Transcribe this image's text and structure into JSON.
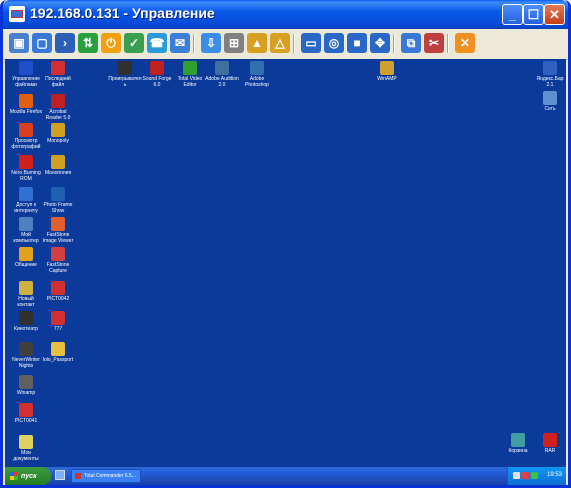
{
  "window": {
    "title": "192.168.0.131 - Управление"
  },
  "window_buttons": [
    {
      "name": "minimize-button",
      "glyph": "_"
    },
    {
      "name": "maximize-button",
      "glyph": "☐"
    },
    {
      "name": "close-button",
      "glyph": "✕"
    }
  ],
  "toolbar": [
    {
      "name": "remote-view-icon",
      "color": "#4a7fd0",
      "glyph": "▣"
    },
    {
      "name": "screen-icon",
      "color": "#3a78d8",
      "glyph": "▢"
    },
    {
      "name": "terminal-icon",
      "color": "#2c5fb8",
      "glyph": "›"
    },
    {
      "name": "file-transfer-icon",
      "color": "#28a040",
      "glyph": "⇅"
    },
    {
      "name": "power-icon",
      "color": "#f0a010",
      "glyph": "⏻"
    },
    {
      "name": "inventory-icon",
      "color": "#3aa050",
      "glyph": "✓"
    },
    {
      "name": "phone-icon",
      "color": "#2a9ad8",
      "glyph": "☎"
    },
    {
      "name": "chat-icon",
      "color": "#3b7ed8",
      "glyph": "✉"
    },
    {
      "name": "download-icon",
      "color": "#3a8ee8",
      "glyph": "⇩"
    },
    {
      "name": "network-icon",
      "color": "#808080",
      "glyph": "⊞"
    },
    {
      "name": "lock-icon",
      "color": "#d8a020",
      "glyph": "▲"
    },
    {
      "name": "unlock-icon",
      "color": "#d8a020",
      "glyph": "△"
    },
    {
      "name": "window-mode-icon",
      "color": "#2a68c8",
      "glyph": "▭"
    },
    {
      "name": "fit-screen-icon",
      "color": "#2a68c8",
      "glyph": "◎"
    },
    {
      "name": "fullscreen-icon",
      "color": "#2a68c8",
      "glyph": "■"
    },
    {
      "name": "full-control-icon",
      "color": "#2a68c8",
      "glyph": "✥"
    },
    {
      "name": "screenshot-icon",
      "color": "#3a78d8",
      "glyph": "⧉"
    },
    {
      "name": "tools-icon",
      "color": "#c04040",
      "glyph": "✂"
    },
    {
      "name": "exit-icon",
      "color": "#f09020",
      "glyph": "✕"
    }
  ],
  "desktop_icons": [
    {
      "name": "desktop-icon-1",
      "label": "Управление файлами",
      "color": "#2050c8"
    },
    {
      "name": "desktop-icon-2",
      "label": "Mozilla Firefox",
      "color": "#e06010"
    },
    {
      "name": "desktop-icon-3",
      "label": "Просмотр фотографий",
      "color": "#d84020"
    },
    {
      "name": "desktop-icon-4",
      "label": "Nero Burning ROM",
      "color": "#d02020"
    },
    {
      "name": "desktop-icon-5",
      "label": "Доступ к интернету",
      "color": "#3070d0"
    },
    {
      "name": "desktop-icon-6",
      "label": "Мой компьютер",
      "color": "#5080c0"
    },
    {
      "name": "desktop-icon-7",
      "label": "Общение",
      "color": "#e0a020"
    },
    {
      "name": "desktop-icon-8",
      "label": "Новый контакт",
      "color": "#d0b040"
    },
    {
      "name": "desktop-icon-9",
      "label": "Кинотеатр",
      "color": "#303030"
    },
    {
      "name": "desktop-icon-10",
      "label": "NeverWinter Nights",
      "color": "#404040"
    },
    {
      "name": "desktop-icon-11",
      "label": "Winamp",
      "color": "#606060"
    },
    {
      "name": "desktop-icon-12",
      "label": "PICT0041",
      "color": "#d03030"
    },
    {
      "name": "desktop-icon-13",
      "label": "Мои документы",
      "color": "#e0d060"
    },
    {
      "name": "desktop-icon-14",
      "label": "Последний файл",
      "color": "#d03030"
    },
    {
      "name": "desktop-icon-15",
      "label": "Acrobat Reader 5.0",
      "color": "#c02020"
    },
    {
      "name": "desktop-icon-16",
      "label": "Monopoly",
      "color": "#d0a020"
    },
    {
      "name": "desktop-icon-17",
      "label": "Монополия",
      "color": "#d0a020"
    },
    {
      "name": "desktop-icon-18",
      "label": "Photo Frame Show",
      "color": "#2060b0"
    },
    {
      "name": "desktop-icon-19",
      "label": "FastStone Image Viewer",
      "color": "#e06030"
    },
    {
      "name": "desktop-icon-20",
      "label": "FastStone Capture",
      "color": "#d04040"
    },
    {
      "name": "desktop-icon-21",
      "label": "PICT0042",
      "color": "#d03030"
    },
    {
      "name": "desktop-icon-22",
      "label": "777",
      "color": "#d03030"
    },
    {
      "name": "desktop-icon-23",
      "label": "lolo_Passport",
      "color": "#e8c040"
    },
    {
      "name": "desktop-icon-24",
      "label": "Проигрыватель",
      "color": "#303030"
    },
    {
      "name": "desktop-icon-25",
      "label": "Sound Forge 6.0",
      "color": "#c02020"
    },
    {
      "name": "desktop-icon-26",
      "label": "Total Video Editor",
      "color": "#30a030"
    },
    {
      "name": "desktop-icon-27",
      "label": "Adobe Audition 2.0",
      "color": "#4070a0"
    },
    {
      "name": "desktop-icon-28",
      "label": "Adobe Photoshop",
      "color": "#3070b0"
    },
    {
      "name": "desktop-icon-29",
      "label": "WinAMP",
      "color": "#d0a030"
    },
    {
      "name": "desktop-icon-30",
      "label": "Яндекс.Бар 2.1",
      "color": "#3060c0"
    },
    {
      "name": "desktop-icon-31",
      "label": "Сеть",
      "color": "#6090d0"
    },
    {
      "name": "desktop-icon-32",
      "label": "Корзина",
      "color": "#40a0a0"
    },
    {
      "name": "desktop-icon-33",
      "label": "RAR",
      "color": "#d02020"
    }
  ],
  "taskbar": {
    "start_label": "пуск",
    "task_label": "Total Commander 6.5...",
    "clock": "19:53"
  }
}
